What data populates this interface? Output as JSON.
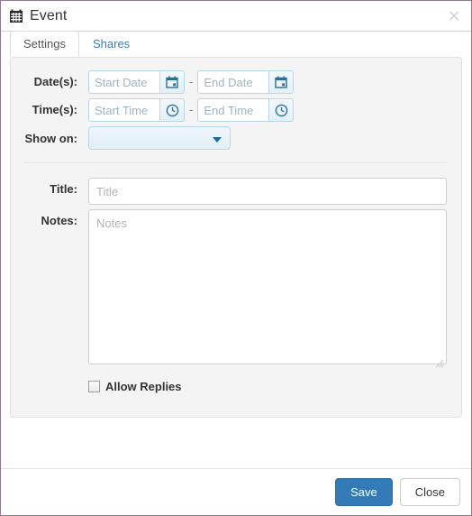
{
  "window": {
    "title": "Event",
    "icon": "calendar-icon",
    "close_label": "×"
  },
  "tabs": [
    {
      "label": "Settings",
      "active": true
    },
    {
      "label": "Shares",
      "active": false
    }
  ],
  "form": {
    "dates": {
      "label": "Date(s):",
      "start_placeholder": "Start Date",
      "start_value": "",
      "end_placeholder": "End Date",
      "end_value": "",
      "separator": "-",
      "picker_icon": "calendar-icon"
    },
    "times": {
      "label": "Time(s):",
      "start_placeholder": "Start Time",
      "start_value": "",
      "end_placeholder": "End Time",
      "end_value": "",
      "separator": "-",
      "picker_icon": "clock-icon"
    },
    "show_on": {
      "label": "Show on:",
      "selected": "",
      "caret_icon": "chevron-down-icon"
    },
    "title": {
      "label": "Title:",
      "placeholder": "Title",
      "value": ""
    },
    "notes": {
      "label": "Notes:",
      "placeholder": "Notes",
      "value": ""
    },
    "allow_replies": {
      "label": "Allow Replies",
      "checked": false
    }
  },
  "footer": {
    "save_label": "Save",
    "close_label": "Close"
  },
  "colors": {
    "primary": "#337ab7",
    "link": "#3b7cb5",
    "panel_bg": "#f4f4f4",
    "dialog_border": "#8c7b8c",
    "input_blue_border": "#b8d7e8"
  }
}
